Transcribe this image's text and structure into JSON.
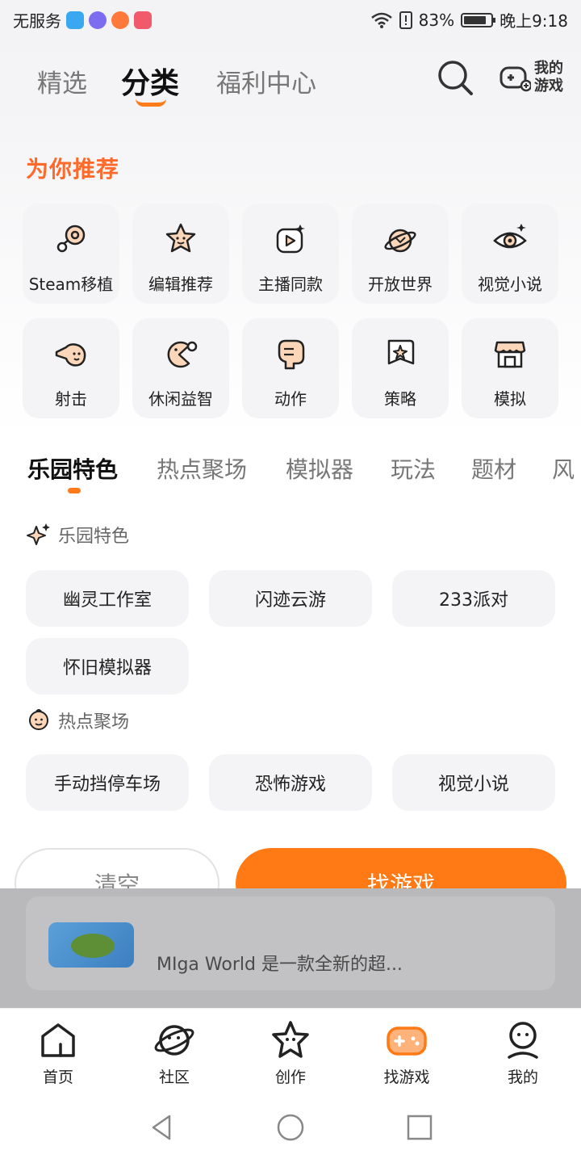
{
  "status_bar": {
    "carrier": "无服务",
    "battery": "83%",
    "battery_level": 0.83,
    "time": "晚上9:18"
  },
  "top_nav": {
    "tabs": [
      {
        "label": "精选"
      },
      {
        "label": "分类"
      },
      {
        "label": "福利中心"
      }
    ],
    "active_tab": "分类",
    "my_games": "我的游戏",
    "accent": "#ff7a1a"
  },
  "recommend": {
    "title": "为你推荐",
    "title_color": "#ff6a2a",
    "categories": [
      {
        "label": "Steam移植",
        "icon": "steam-icon"
      },
      {
        "label": "编辑推荐",
        "icon": "star-face-icon"
      },
      {
        "label": "主播同款",
        "icon": "play-video-icon"
      },
      {
        "label": "开放世界",
        "icon": "planet-icon"
      },
      {
        "label": "视觉小说",
        "icon": "eye-icon"
      },
      {
        "label": "射击",
        "icon": "shooter-face-icon"
      },
      {
        "label": "休闲益智",
        "icon": "pacman-icon"
      },
      {
        "label": "动作",
        "icon": "fist-icon"
      },
      {
        "label": "策略",
        "icon": "map-flag-icon"
      },
      {
        "label": "模拟",
        "icon": "shop-icon"
      }
    ]
  },
  "sub_tabs": [
    {
      "label": "乐园特色"
    },
    {
      "label": "热点聚场"
    },
    {
      "label": "模拟器"
    },
    {
      "label": "玩法"
    },
    {
      "label": "题材"
    },
    {
      "label": "风"
    }
  ],
  "sections": [
    {
      "title": "乐园特色",
      "icon": "sparkle-icon",
      "chips": [
        "幽灵工作室",
        "闪迹云游",
        "233派对",
        "怀旧模拟器"
      ]
    },
    {
      "title": "热点聚场",
      "icon": "smile-badge-icon",
      "chips": [
        "手动挡停车场",
        "恐怖游戏",
        "视觉小说"
      ]
    }
  ],
  "actions": {
    "clear": "清空",
    "find": "找游戏",
    "find_color": "#ff7a14"
  },
  "background_card": {
    "text": "MIga World 是一款全新的超..."
  },
  "bottom_nav": [
    {
      "label": "首页",
      "icon": "home-icon"
    },
    {
      "label": "社区",
      "icon": "planet-face-icon"
    },
    {
      "label": "创作",
      "icon": "star-create-icon"
    },
    {
      "label": "找游戏",
      "icon": "gamepad-icon"
    },
    {
      "label": "我的",
      "icon": "profile-icon"
    }
  ],
  "system_nav": [
    "back-icon",
    "home-circle-icon",
    "recents-icon"
  ]
}
